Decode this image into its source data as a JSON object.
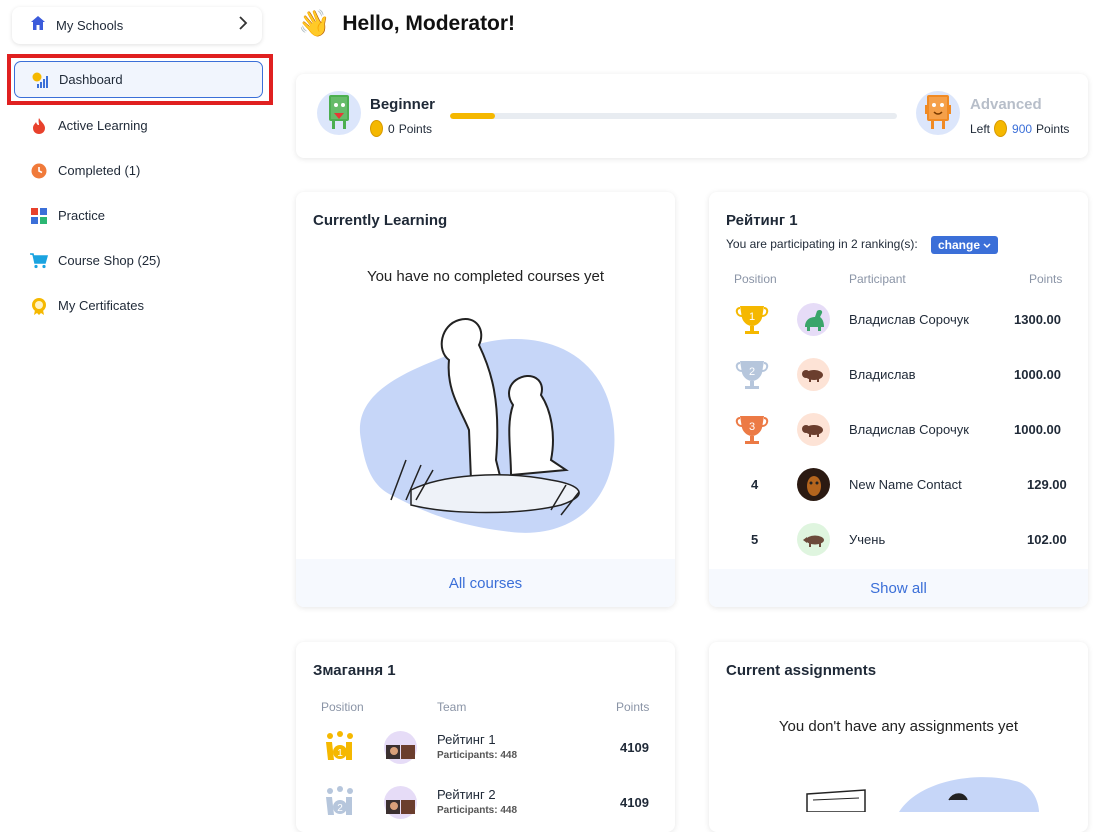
{
  "sidebar": {
    "school_label": "My Schools",
    "items": [
      {
        "label": "Dashboard",
        "icon": "dashboard-icon"
      },
      {
        "label": "Active Learning",
        "icon": "flame-icon"
      },
      {
        "label": "Completed (1)",
        "icon": "clock-icon"
      },
      {
        "label": "Practice",
        "icon": "blocks-icon"
      },
      {
        "label": "Course Shop (25)",
        "icon": "cart-icon"
      },
      {
        "label": "My Certificates",
        "icon": "badge-icon"
      }
    ]
  },
  "header": {
    "greeting": "Hello, Moderator!"
  },
  "progress": {
    "current_level": "Beginner",
    "current_points": "0",
    "points_word": "Points",
    "next_level": "Advanced",
    "left_word": "Left",
    "left_points": "900",
    "fill_fraction": 0.1
  },
  "currently_learning": {
    "title": "Currently Learning",
    "empty_message": "You have no completed courses yet",
    "footer_link": "All courses"
  },
  "ranking": {
    "title": "Рейтинг 1",
    "subtitle": "You are participating in 2 ranking(s):",
    "change_label": "change",
    "headers": {
      "position": "Position",
      "participant": "Participant",
      "points": "Points"
    },
    "rows": [
      {
        "position": "1",
        "name": "Владислав Сорочук",
        "points": "1300.00"
      },
      {
        "position": "2",
        "name": "Владислав",
        "points": "1000.00"
      },
      {
        "position": "3",
        "name": "Владислав Сорочук",
        "points": "1000.00"
      },
      {
        "position": "4",
        "name": "New Name Contact",
        "points": "129.00"
      },
      {
        "position": "5",
        "name": "Учень",
        "points": "102.00"
      }
    ],
    "footer_link": "Show all"
  },
  "competition": {
    "title": "Змагання 1",
    "headers": {
      "position": "Position",
      "team": "Team",
      "points": "Points"
    },
    "rows": [
      {
        "position": "1",
        "team": "Рейтинг 1",
        "participants": "Participants: 448",
        "points": "4109"
      },
      {
        "position": "2",
        "team": "Рейтинг 2",
        "participants": "Participants: 448",
        "points": "4109"
      }
    ]
  },
  "assignments": {
    "title": "Current assignments",
    "empty_message": "You don't have any assignments yet"
  },
  "colors": {
    "accent": "#3b6fd8",
    "gold": "#f5b800",
    "highlight": "#e02020"
  }
}
